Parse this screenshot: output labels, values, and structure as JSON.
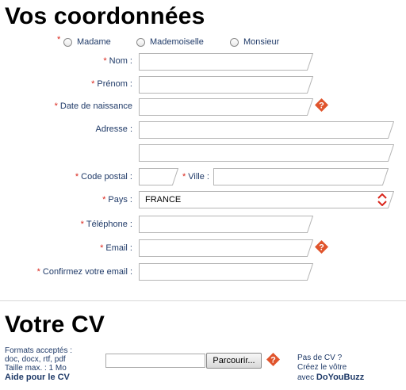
{
  "contact": {
    "title": "Vos coordonnées",
    "required_marker": "*",
    "civility": {
      "options": [
        "Madame",
        "Mademoiselle",
        "Monsieur"
      ]
    },
    "labels": {
      "nom": "Nom :",
      "prenom": "Prénom :",
      "date_naissance": "Date de naissance",
      "adresse": "Adresse :",
      "code_postal": "Code postal :",
      "ville": "Ville :",
      "pays": "Pays :",
      "telephone": "Téléphone :",
      "email": "Email :",
      "confirm_email": "Confirmez votre email :"
    },
    "values": {
      "pays": "FRANCE"
    }
  },
  "cv": {
    "title": "Votre CV",
    "formats_line1": "Formats acceptés :",
    "formats_line2": "doc, docx, rtf, pdf",
    "max_size": "Taille max. : 1 Mo",
    "help_link": "Aide pour le CV",
    "browse_button": "Parcourir...",
    "no_cv_line1": "Pas de CV ?",
    "no_cv_line2": "Créez le vôtre",
    "no_cv_line3_prefix": "avec",
    "doyoubuzz_link": "DoYouBuzz"
  },
  "colors": {
    "label": "#1f3a68",
    "required": "#d9261c",
    "help_icon": "#e0542c"
  },
  "icons": {
    "help": "question-diamond-icon",
    "select": "up-down-arrows-icon"
  }
}
